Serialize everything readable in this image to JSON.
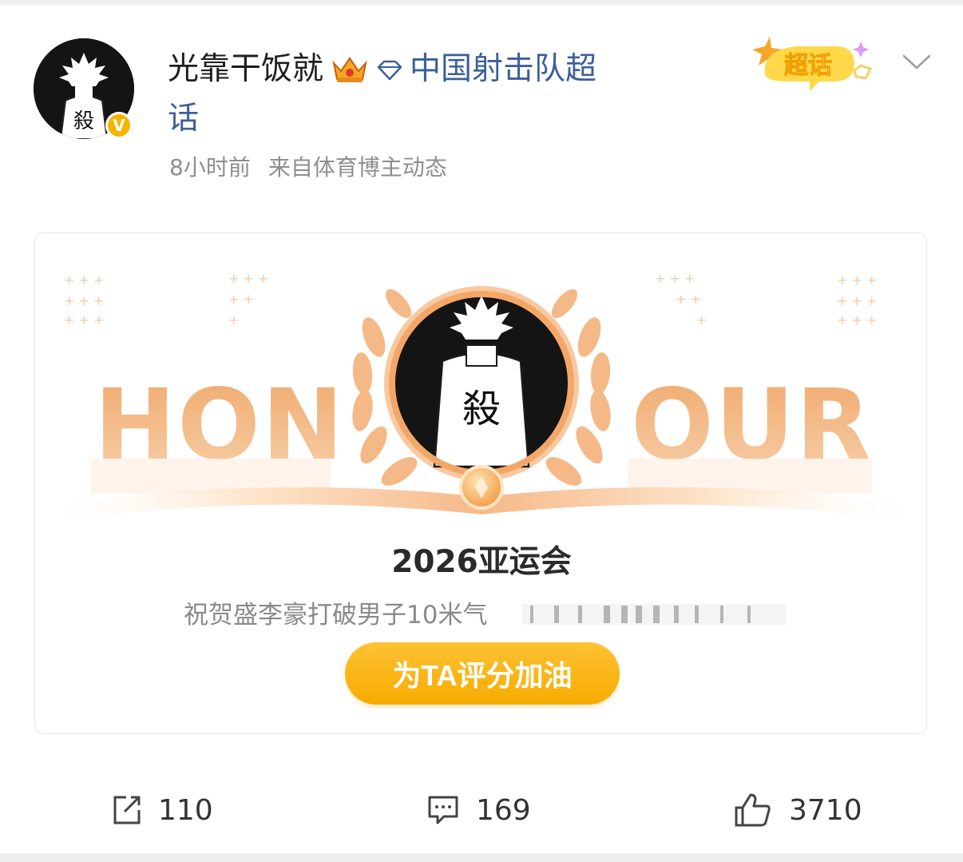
{
  "post": {
    "username": "光靠干饭就",
    "topic_line1": "中国射击队超",
    "topic_line2": "话",
    "time": "8小时前",
    "source": "来自体育博主动态",
    "avatar_text": "殺",
    "verified_mark": "V",
    "badge_text": "超话"
  },
  "card": {
    "banner_left": "HON",
    "banner_right": "OUR",
    "medal_text": "殺",
    "event_title": "2026亚运会",
    "event_desc": "祝贺盛李豪打破男子10米气",
    "button_label": "为TA评分加油"
  },
  "actions": {
    "repost_count": "110",
    "comment_count": "169",
    "like_count": "3710"
  },
  "colors": {
    "topic_blue": "#3b5f9a",
    "accent_orange": "#f6ab00",
    "honour_peach": "#f2b47e"
  }
}
